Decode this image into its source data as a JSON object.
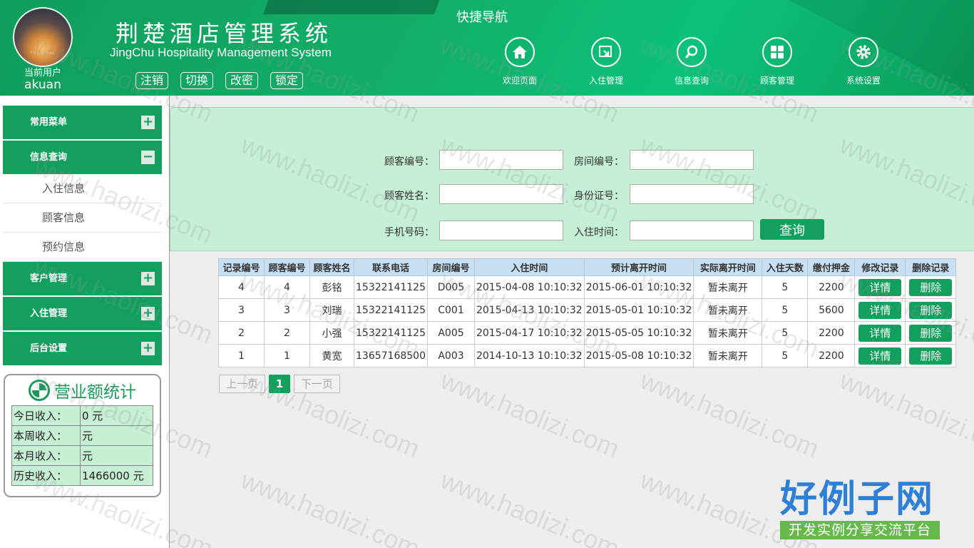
{
  "header": {
    "avatar_text": "THE RIVAL",
    "current_user_label": "当前用户",
    "username": "akuan",
    "title_cn": "荆楚酒店管理系统",
    "title_en": "JingChu Hospitality Management System",
    "buttons": [
      "注销",
      "切换",
      "改密",
      "锁定"
    ],
    "quick_nav_title": "快捷导航",
    "quick_nav": [
      {
        "label": "欢迎页面",
        "icon": "home-icon"
      },
      {
        "label": "入住管理",
        "icon": "checkin-icon"
      },
      {
        "label": "信息查询",
        "icon": "search-icon"
      },
      {
        "label": "顾客管理",
        "icon": "grid-icon"
      },
      {
        "label": "系统设置",
        "icon": "gear-icon"
      }
    ]
  },
  "sidebar": {
    "menus": [
      {
        "label": "常用菜单",
        "toggle": "+"
      },
      {
        "label": "信息查询",
        "toggle": "−",
        "items": [
          "入住信息",
          "顾客信息",
          "预约信息"
        ]
      },
      {
        "label": "客户管理",
        "toggle": "+"
      },
      {
        "label": "入住管理",
        "toggle": "+"
      },
      {
        "label": "后台设置",
        "toggle": "+"
      }
    ],
    "stats": {
      "title": "营业额统计",
      "rows": [
        {
          "k": "今日收入：",
          "v": "0 元"
        },
        {
          "k": "本周收入：",
          "v": "元"
        },
        {
          "k": "本月收入：",
          "v": "元"
        },
        {
          "k": "历史收入：",
          "v": "1466000 元"
        }
      ]
    }
  },
  "search": {
    "customer_id": "顾客编号：",
    "room_id": "房间编号：",
    "customer_name": "顾客姓名：",
    "id_number": "身份证号：",
    "phone": "手机号码：",
    "checkin_time": "入住时间：",
    "query_button": "查询"
  },
  "table": {
    "headers": [
      "记录编号",
      "顾客编号",
      "顾客姓名",
      "联系电话",
      "房间编号",
      "入住时间",
      "预计离开时间",
      "实际离开时间",
      "入住天数",
      "缴付押金",
      "修改记录",
      "删除记录"
    ],
    "detail_label": "详情",
    "delete_label": "删除",
    "rows": [
      [
        "4",
        "4",
        "彭铭",
        "15322141125",
        "D005",
        "2015-04-08 10:10:32",
        "2015-06-01 10:10:32",
        "暂未离开",
        "5",
        "2200"
      ],
      [
        "3",
        "3",
        "刘瑞",
        "15322141125",
        "C001",
        "2015-04-13 10:10:32",
        "2015-05-01 10:10:32",
        "暂未离开",
        "5",
        "5600"
      ],
      [
        "2",
        "2",
        "小强",
        "15322141125",
        "A005",
        "2015-04-17 10:10:32",
        "2015-05-05 10:10:32",
        "暂未离开",
        "5",
        "2200"
      ],
      [
        "1",
        "1",
        "黄宽",
        "13657168500",
        "A003",
        "2014-10-13 10:10:32",
        "2015-05-08 10:10:32",
        "暂未离开",
        "5",
        "2200"
      ]
    ]
  },
  "pager": {
    "prev": "上一页",
    "current": "1",
    "next": "下一页"
  },
  "watermark": {
    "text": "www.haolizi.com",
    "brand_big": "好例子网",
    "brand_small": "开发实例分享交流平台"
  }
}
